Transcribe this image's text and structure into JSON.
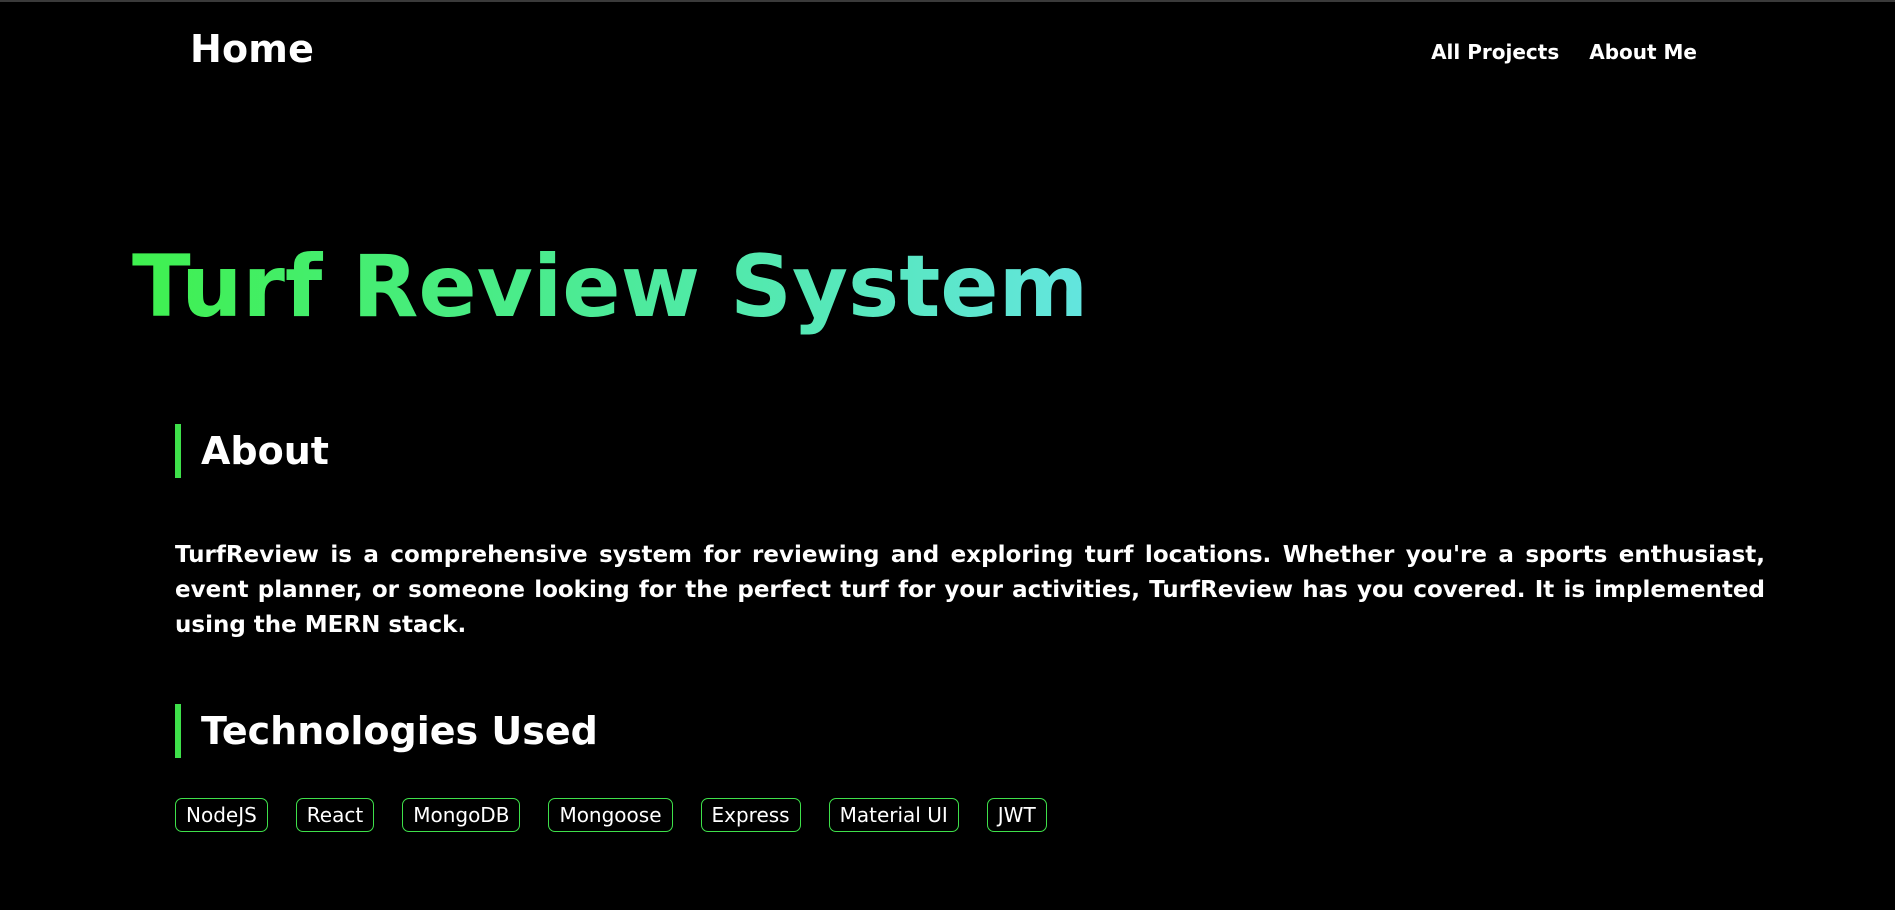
{
  "nav": {
    "brand": "Home",
    "links": [
      "All Projects",
      "About Me"
    ]
  },
  "hero": {
    "title": "Turf Review System"
  },
  "about": {
    "heading": "About",
    "text": "TurfReview is a comprehensive system for reviewing and exploring turf locations. Whether you're a sports enthusiast, event planner, or someone looking for the perfect turf for your activities, TurfReview has you covered. It is implemented using the MERN stack."
  },
  "technologies": {
    "heading": "Technologies Used",
    "items": [
      "NodeJS",
      "React",
      "MongoDB",
      "Mongoose",
      "Express",
      "Material UI",
      "JWT"
    ]
  },
  "colors": {
    "background": "#000000",
    "accent": "#3ee04a",
    "title_gradient_start": "#3ff04f",
    "title_gradient_end": "#63e5df"
  }
}
